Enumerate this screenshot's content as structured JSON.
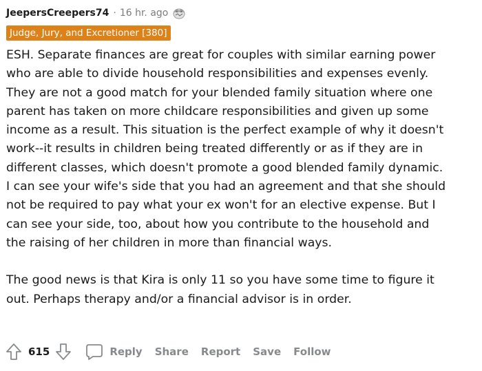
{
  "comment": {
    "username": "JeepersCreepers74",
    "separator": "·",
    "time": "16 hr. ago",
    "award_icon": "award-badge-icon",
    "flair": "Judge, Jury, and Excretioner [380]",
    "flair_color": "#dd8119",
    "paragraphs": [
      "ESH. Separate finances are great for couples with similar earning power\nwho are able to divide household responsibilities and expenses evenly.\nThey are not a good match for your blended family situation where one\nparent has taken on more childcare responsibilities and given up some\nincome as a result. This situation is the perfect example of why it doesn't\nwork--it results in children being treated differently or as if they are in\ndifferent classes, which doesn't promote a good blended family dynamic.\nI can see your wife's side that you had an agreement and that she should\nnot be required to pay what your ex won't for an elective expense. But I\ncan see your side, too, about how you contribute to the household and\nthe raising of her children in more than financial ways.",
      "The good news is that Kira is only 11 so you have some time to figure it\nout. Perhaps therapy and/or a financial advisor is in order."
    ]
  },
  "actions": {
    "upvote_icon": "upvote-arrow-icon",
    "score": "615",
    "downvote_icon": "downvote-arrow-icon",
    "reply_icon": "speech-bubble-icon",
    "reply": "Reply",
    "share": "Share",
    "report": "Report",
    "save": "Save",
    "follow": "Follow"
  }
}
